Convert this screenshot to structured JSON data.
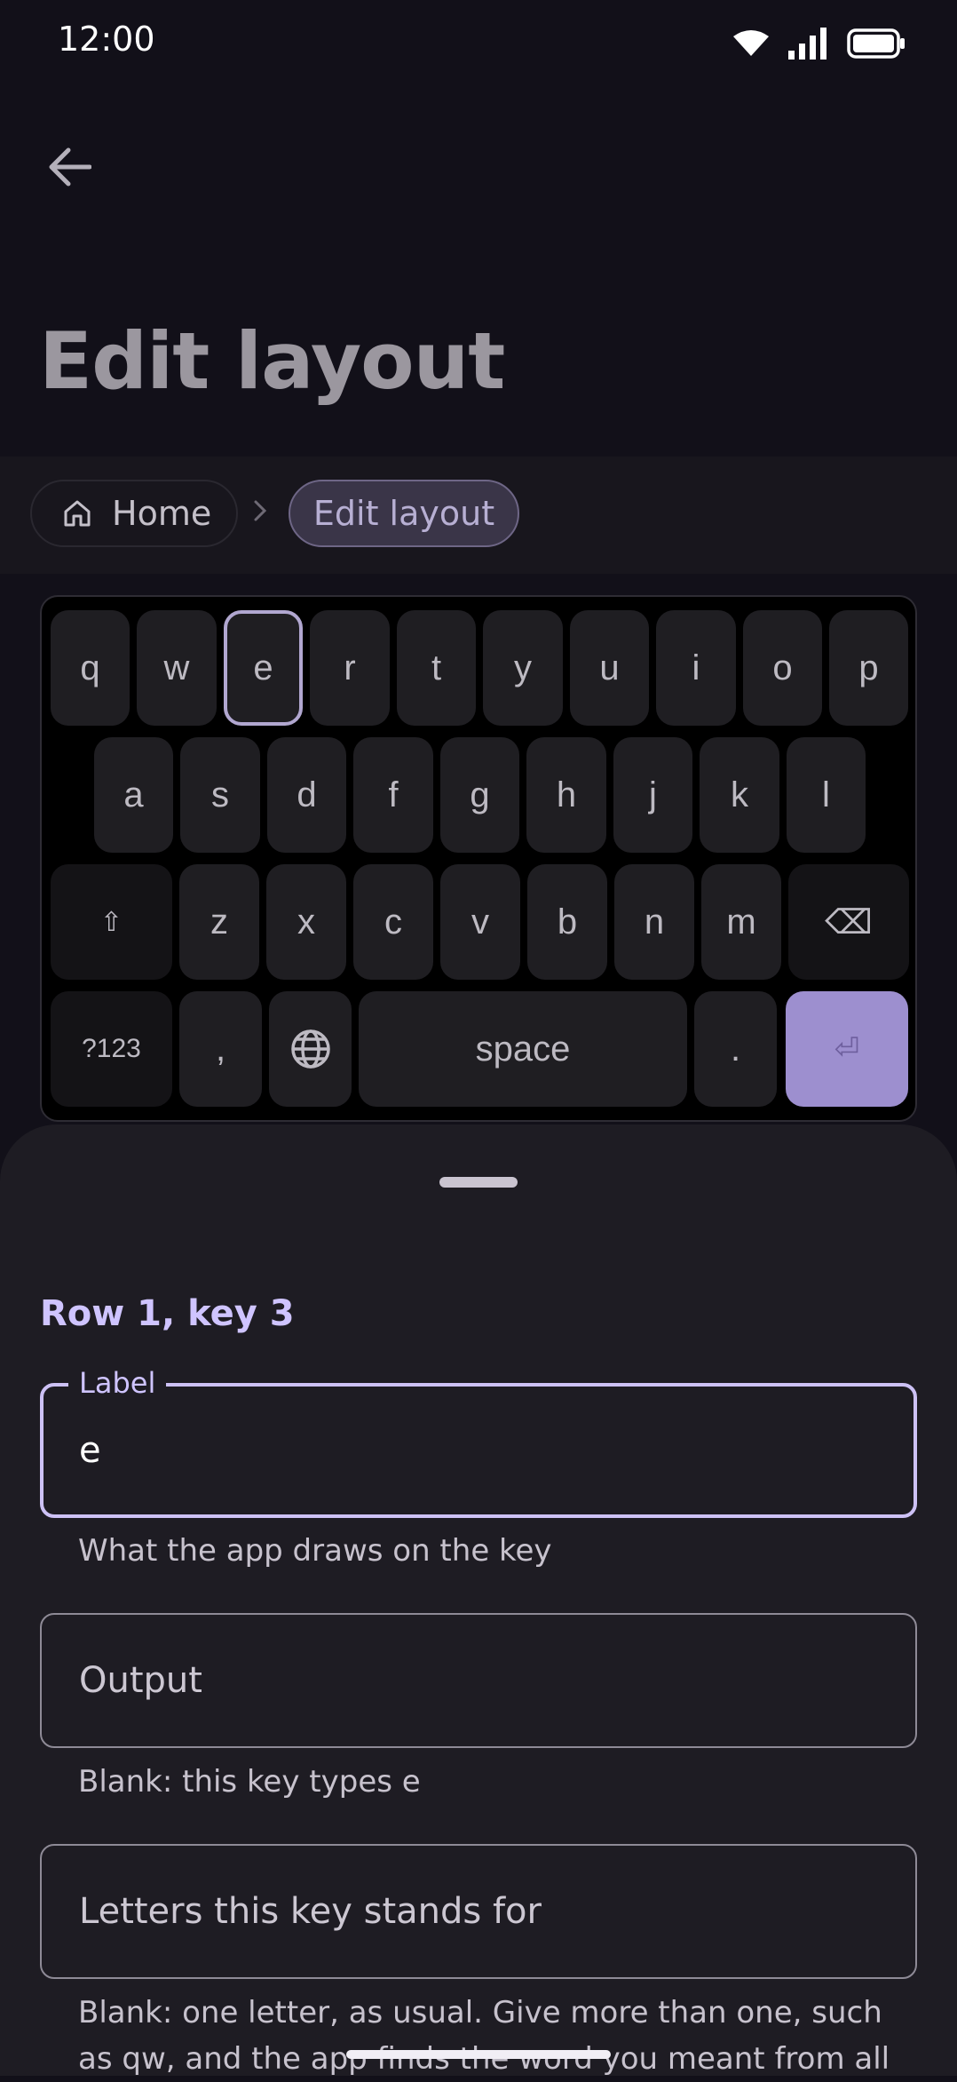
{
  "status_bar": {
    "time": "12:00",
    "icons": [
      "wifi-icon",
      "signal-icon",
      "battery-icon"
    ]
  },
  "app_bar": {
    "back_icon": "arrow-left-icon",
    "title": "Edit layout"
  },
  "breadcrumb": {
    "home_label": "Home",
    "home_icon": "home-icon",
    "separator_icon": "chevron-right-icon",
    "current_label": "Edit layout"
  },
  "keyboard": {
    "rows": [
      [
        "q",
        "w",
        "e",
        "r",
        "t",
        "y",
        "u",
        "i",
        "o",
        "p"
      ],
      [
        "a",
        "s",
        "d",
        "f",
        "g",
        "h",
        "j",
        "k",
        "l"
      ],
      [
        "⇧",
        "z",
        "x",
        "c",
        "v",
        "b",
        "n",
        "m",
        "⌫"
      ],
      [
        "?123",
        ",",
        "globe",
        "space",
        ".",
        "⏎"
      ]
    ],
    "selected": {
      "row": 1,
      "key": 3
    },
    "colors": {
      "selected_border": "#b1a7d0",
      "enter_fill": "#9d8fcf"
    }
  },
  "sheet": {
    "title": "Row 1, key 3",
    "label_field": {
      "caption": "Label",
      "value": "e",
      "helper": "What the app draws on the key"
    },
    "output_field": {
      "placeholder": "Output",
      "value": "",
      "helper": "Blank: this key types e"
    },
    "letters_field": {
      "placeholder": "Letters this key stands for",
      "value": "",
      "helper": "Blank: one letter, as usual. Give more than one, such as qw, and the app finds the word you meant from all"
    }
  },
  "colors": {
    "accent": "#cfc4ff",
    "background": "#121019",
    "sheet": "#1e1c23"
  }
}
